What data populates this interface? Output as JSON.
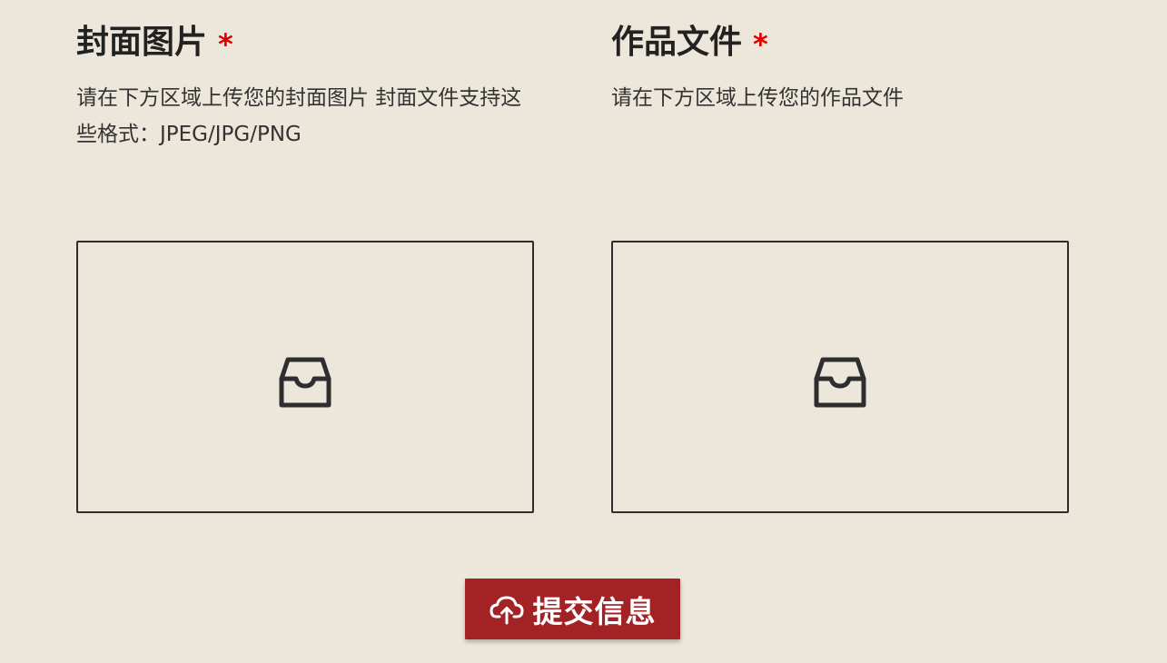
{
  "cover": {
    "title": "封面图片",
    "required_mark": "*",
    "description": "请在下方区域上传您的封面图片 封面文件支持这些格式：JPEG/JPG/PNG",
    "icon": "inbox-icon"
  },
  "work": {
    "title": "作品文件",
    "required_mark": "*",
    "description": "请在下方区域上传您的作品文件",
    "icon": "inbox-icon"
  },
  "submit": {
    "label": "提交信息",
    "icon": "cloud-upload-icon"
  },
  "colors": {
    "background": "#ede7db",
    "accent": "#a22226",
    "required": "#e00000",
    "border": "#2e2e2e"
  }
}
